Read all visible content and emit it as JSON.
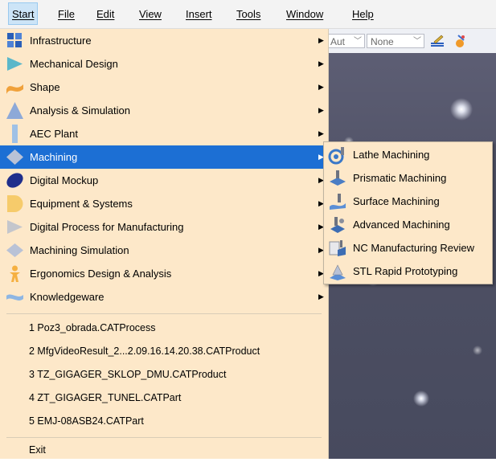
{
  "menubar": {
    "items": [
      {
        "label": "Start",
        "active": true
      },
      {
        "label": "File"
      },
      {
        "label": "Edit"
      },
      {
        "label": "View"
      },
      {
        "label": "Insert"
      },
      {
        "label": "Tools"
      },
      {
        "label": "Window"
      },
      {
        "label": "Help"
      }
    ]
  },
  "toolbar": {
    "combo1_value": "Aut",
    "combo2_value": "None"
  },
  "start_menu": {
    "items": [
      {
        "label": "Infrastructure",
        "icon": "infrastructure-icon"
      },
      {
        "label": "Mechanical Design",
        "icon": "mechanical-design-icon"
      },
      {
        "label": "Shape",
        "icon": "shape-icon"
      },
      {
        "label": "Analysis & Simulation",
        "icon": "analysis-simulation-icon"
      },
      {
        "label": "AEC Plant",
        "icon": "aec-plant-icon"
      },
      {
        "label": "Machining",
        "icon": "machining-icon",
        "highlighted": true
      },
      {
        "label": "Digital Mockup",
        "icon": "digital-mockup-icon"
      },
      {
        "label": "Equipment & Systems",
        "icon": "equipment-systems-icon"
      },
      {
        "label": "Digital Process for Manufacturing",
        "icon": "digital-process-icon"
      },
      {
        "label": "Machining Simulation",
        "icon": "machining-simulation-icon"
      },
      {
        "label": "Ergonomics Design & Analysis",
        "icon": "ergonomics-icon"
      },
      {
        "label": "Knowledgeware",
        "icon": "knowledgeware-icon"
      }
    ],
    "recent_files": [
      {
        "label": "1 Poz3_obrada.CATProcess"
      },
      {
        "label": "2 MfgVideoResult_2...2.09.16.14.20.38.CATProduct"
      },
      {
        "label": "3 TZ_GIGAGER_SKLOP_DMU.CATProduct"
      },
      {
        "label": "4 ZT_GIGAGER_TUNEL.CATPart"
      },
      {
        "label": "5 EMJ-08ASB24.CATPart"
      }
    ],
    "exit_label": "Exit"
  },
  "machining_submenu": {
    "items": [
      {
        "label": "Lathe Machining",
        "icon": "lathe-machining-icon"
      },
      {
        "label": "Prismatic Machining",
        "icon": "prismatic-machining-icon"
      },
      {
        "label": "Surface Machining",
        "icon": "surface-machining-icon"
      },
      {
        "label": "Advanced Machining",
        "icon": "advanced-machining-icon"
      },
      {
        "label": "NC Manufacturing Review",
        "icon": "nc-manufacturing-review-icon"
      },
      {
        "label": "STL Rapid Prototyping",
        "icon": "stl-rapid-prototyping-icon"
      }
    ]
  },
  "colors": {
    "menu_bg": "#fde8c9",
    "highlight": "#1c6fd4",
    "menubar_active": "#cce4f7"
  }
}
